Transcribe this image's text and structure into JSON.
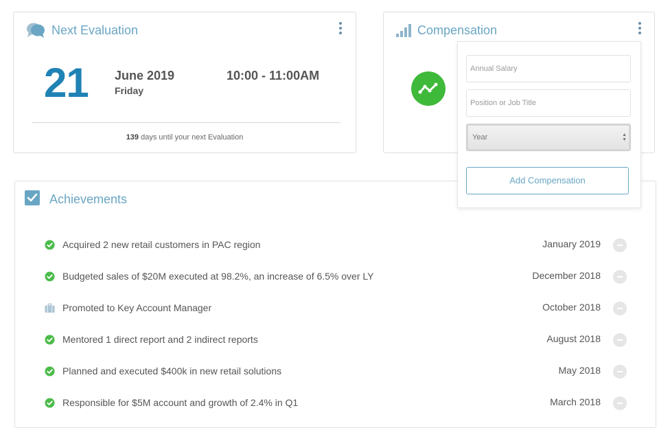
{
  "evaluation": {
    "title": "Next Evaluation",
    "day": "21",
    "month_year": "June 2019",
    "weekday": "Friday",
    "time_range": "10:00 - 11:00AM",
    "days_count": "139",
    "days_text": "days until your next Evaluation"
  },
  "compensation": {
    "title": "Compensation",
    "form": {
      "salary_placeholder": "Annual Salary",
      "position_placeholder": "Position or Job Title",
      "year_label": "Year",
      "submit_label": "Add Compensation"
    }
  },
  "achievements": {
    "title": "Achievements",
    "items": [
      {
        "text": "Acquired 2 new retail customers in PAC region",
        "date": "January 2019",
        "icon": "check-circle-icon"
      },
      {
        "text": "Budgeted sales of $20M executed at 98.2%, an increase of 6.5% over LY",
        "date": "December 2018",
        "icon": "check-circle-icon"
      },
      {
        "text": "Promoted to Key Account Manager",
        "date": "October 2018",
        "icon": "briefcase-icon"
      },
      {
        "text": "Mentored 1 direct report and 2 indirect reports",
        "date": "August 2018",
        "icon": "check-circle-icon"
      },
      {
        "text": "Planned and executed $400k in new retail solutions",
        "date": "May 2018",
        "icon": "check-circle-icon"
      },
      {
        "text": "Responsible for $5M account and growth of 2.4% in Q1",
        "date": "March 2018",
        "icon": "check-circle-icon"
      }
    ]
  },
  "colors": {
    "accent": "#6aa6c4",
    "date_blue": "#1f82b4",
    "success_green": "#3fb93a",
    "briefcase": "#a9c3d3"
  }
}
